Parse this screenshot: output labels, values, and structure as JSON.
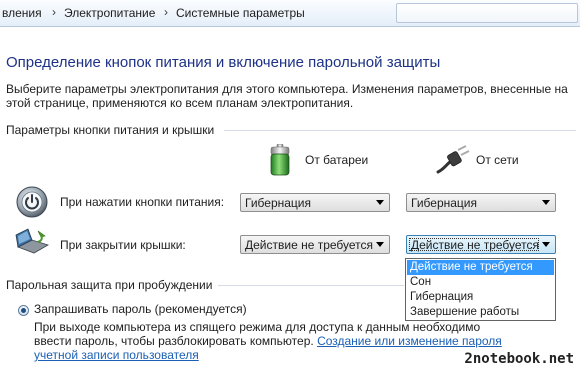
{
  "breadcrumb": {
    "items": [
      "вления",
      "Электропитание",
      "Системные параметры"
    ],
    "separator": "›"
  },
  "page": {
    "title": "Определение кнопок питания и включение парольной защиты",
    "description": "Выберите параметры электропитания для этого компьютера. Изменения параметров, внесенные на этой странице, применяются ко всем планам электропитания."
  },
  "power_buttons": {
    "section_label": "Параметры кнопки питания и крышки",
    "col_battery": "От батареи",
    "col_ac": "От сети",
    "rows": [
      {
        "label": "При нажатии кнопки питания:",
        "battery": "Гибернация",
        "ac": "Гибернация"
      },
      {
        "label": "При закрытии крышки:",
        "battery": "Действие не требуется",
        "ac": "Действие не требуется"
      }
    ],
    "dropdown_options": [
      "Действие не требуется",
      "Сон",
      "Гибернация",
      "Завершение работы"
    ],
    "dropdown_selected": "Действие не требуется"
  },
  "password": {
    "section_label": "Парольная защита при пробуждении",
    "option_label": "Запрашивать пароль (рекомендуется)",
    "option_desc": "При выходе компьютера из спящего режима для доступа к данным необходимо ввести пароль, чтобы разблокировать компьютер.",
    "link": "Создание или изменение пароля учетной записи пользователя"
  },
  "watermark": "2notebook.net",
  "colors": {
    "title": "#1e3287",
    "link": "#1a5fb4",
    "dropdown_highlight": "#3399ff"
  }
}
